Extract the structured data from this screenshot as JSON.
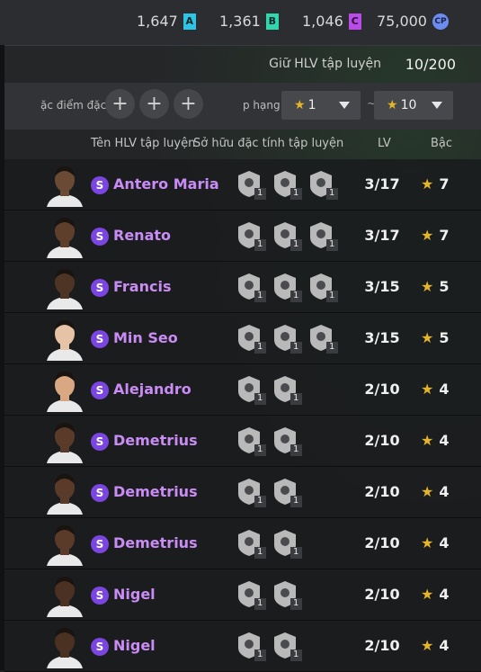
{
  "currencies": [
    {
      "value": "1,647",
      "badge": "A"
    },
    {
      "value": "1,361",
      "badge": "B"
    },
    {
      "value": "1,046",
      "badge": "C"
    },
    {
      "value": "75,000",
      "badge": "CP"
    }
  ],
  "holding": {
    "label": "Giữ HLV tập luyện",
    "count": "10/200"
  },
  "filter": {
    "trait_label": "ặc điểm đặc",
    "rank_label": "p hạng",
    "rank_min": "1",
    "rank_max": "10",
    "separator": "~"
  },
  "columns": {
    "name": "Tên HLV tập luyện",
    "traits": "Sở hữu đặc tính tập luyện",
    "lv": "LV",
    "rank": "Bậc"
  },
  "coaches": [
    {
      "name": "Antero Maria",
      "lv": "3/17",
      "rank": "7",
      "skin": "#6b4a35",
      "traits": [
        {
          "count": "1"
        },
        {
          "count": "1"
        },
        {
          "count": "1"
        }
      ]
    },
    {
      "name": "Renato",
      "lv": "3/17",
      "rank": "7",
      "skin": "#5e3f2c",
      "traits": [
        {
          "count": "1"
        },
        {
          "count": "1"
        },
        {
          "count": "1"
        }
      ]
    },
    {
      "name": "Francis",
      "lv": "3/15",
      "rank": "5",
      "skin": "#4e3425",
      "traits": [
        {
          "count": "1"
        },
        {
          "count": "1"
        },
        {
          "count": "1"
        }
      ]
    },
    {
      "name": "Min Seo",
      "lv": "3/15",
      "rank": "5",
      "skin": "#e6c3a6",
      "traits": [
        {
          "count": "1"
        },
        {
          "count": "1"
        },
        {
          "count": "1"
        }
      ]
    },
    {
      "name": "Alejandro",
      "lv": "2/10",
      "rank": "4",
      "skin": "#d9a882",
      "traits": [
        {
          "count": "1"
        },
        {
          "count": "1"
        }
      ]
    },
    {
      "name": "Demetrius",
      "lv": "2/10",
      "rank": "4",
      "skin": "#5a3b29",
      "traits": [
        {
          "count": "1"
        },
        {
          "count": "1"
        }
      ]
    },
    {
      "name": "Demetrius",
      "lv": "2/10",
      "rank": "4",
      "skin": "#5a3b29",
      "traits": [
        {
          "count": "1"
        },
        {
          "count": "1"
        }
      ]
    },
    {
      "name": "Demetrius",
      "lv": "2/10",
      "rank": "4",
      "skin": "#5a3b29",
      "traits": [
        {
          "count": "1"
        },
        {
          "count": "1"
        }
      ]
    },
    {
      "name": "Nigel",
      "lv": "2/10",
      "rank": "4",
      "skin": "#4a3122",
      "traits": [
        {
          "count": "1"
        },
        {
          "count": "1"
        }
      ]
    },
    {
      "name": "Nigel",
      "lv": "2/10",
      "rank": "4",
      "skin": "#4a3122",
      "traits": [
        {
          "count": "1"
        },
        {
          "count": "1"
        }
      ]
    }
  ],
  "colors": {
    "accent_name": "#c98cf5",
    "star": "#e5b52a",
    "s_badge": "#7a45e0"
  }
}
